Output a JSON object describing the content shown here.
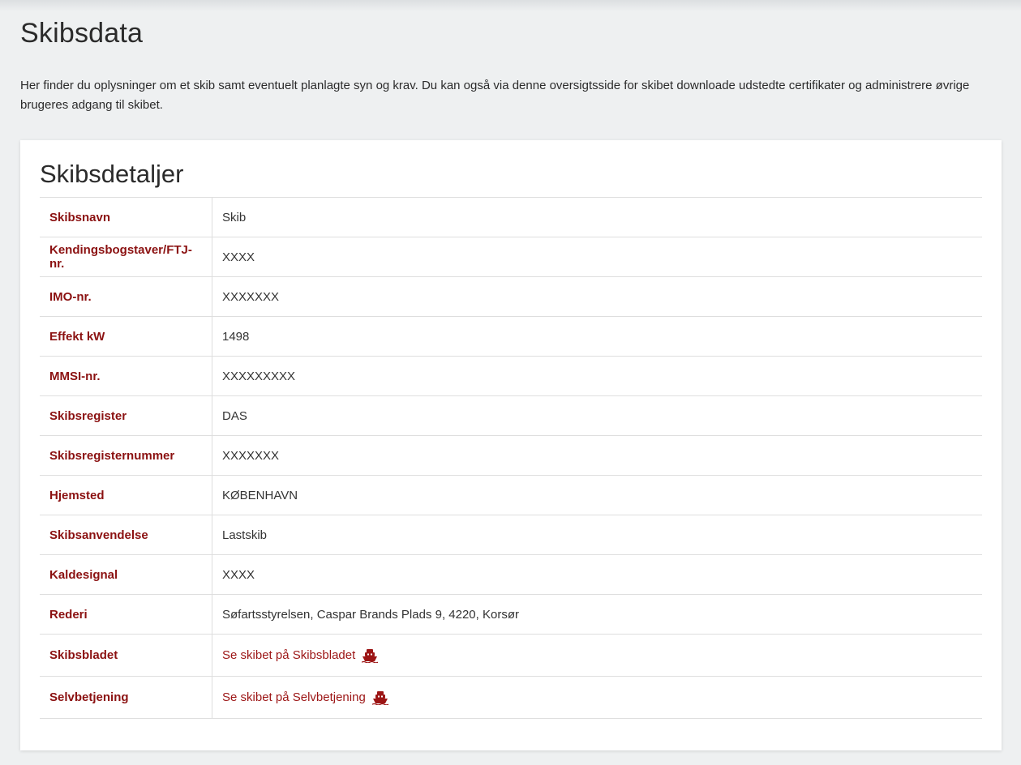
{
  "page": {
    "title": "Skibsdata",
    "intro": "Her finder du oplysninger om et skib samt eventuelt planlagte syn og krav. Du kan også via denne oversigtsside for skibet downloade udstedte certifikater og administrere øvrige brugeres adgang til skibet."
  },
  "card": {
    "title": "Skibsdetaljer",
    "rows": [
      {
        "label": "Skibsnavn",
        "value": "Skib"
      },
      {
        "label": "Kendingsbogstaver/FTJ-nr.",
        "value": "XXXX"
      },
      {
        "label": "IMO-nr.",
        "value": "XXXXXXX"
      },
      {
        "label": "Effekt kW",
        "value": "1498"
      },
      {
        "label": "MMSI-nr.",
        "value": "XXXXXXXXX"
      },
      {
        "label": "Skibsregister",
        "value": "DAS"
      },
      {
        "label": "Skibsregisternummer",
        "value": "XXXXXXX"
      },
      {
        "label": "Hjemsted",
        "value": "KØBENHAVN"
      },
      {
        "label": "Skibsanvendelse",
        "value": "Lastskib"
      },
      {
        "label": "Kaldesignal",
        "value": "XXXX"
      },
      {
        "label": "Rederi",
        "value": "Søfartsstyrelsen, Caspar Brands Plads 9, 4220, Korsør"
      },
      {
        "label": "Skibsbladet",
        "link_text": "Se skibet på Skibsbladet",
        "icon": "ship-icon"
      },
      {
        "label": "Selvbetjening",
        "link_text": "Se skibet på Selvbetjening",
        "icon": "ship-icon"
      }
    ]
  },
  "colors": {
    "label": "#8b1111",
    "link": "#9c1515",
    "background": "#eef0f1",
    "card": "#ffffff"
  }
}
